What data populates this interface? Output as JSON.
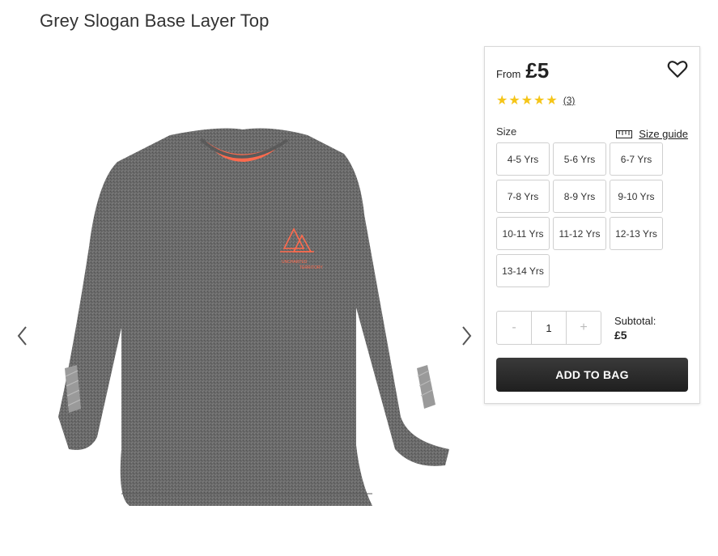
{
  "product": {
    "title": "Grey Slogan Base Layer Top",
    "image_print_text": [
      "UNCHARTED",
      "TERRITORY"
    ]
  },
  "gallery": {
    "prev_icon": "chevron-left-icon",
    "next_icon": "chevron-right-icon"
  },
  "panel": {
    "from_label": "From",
    "price": "£5",
    "wishlist_icon": "heart-icon",
    "stars": "★★★★★",
    "rating_value": 5,
    "review_count": "(3)",
    "size_label": "Size",
    "size_guide_label": "Size guide",
    "sizes": [
      "4-5 Yrs",
      "5-6 Yrs",
      "6-7 Yrs",
      "7-8 Yrs",
      "8-9 Yrs",
      "9-10 Yrs",
      "10-11 Yrs",
      "11-12 Yrs",
      "12-13 Yrs",
      "13-14 Yrs"
    ],
    "quantity": {
      "minus": "-",
      "value": "1",
      "plus": "+"
    },
    "subtotal_label": "Subtotal:",
    "subtotal_value": "£5",
    "add_to_bag_label": "ADD TO BAG"
  },
  "colors": {
    "star": "#f5c518",
    "button_bg": "#2a2a2a",
    "accent_print": "#ff6a4d"
  }
}
